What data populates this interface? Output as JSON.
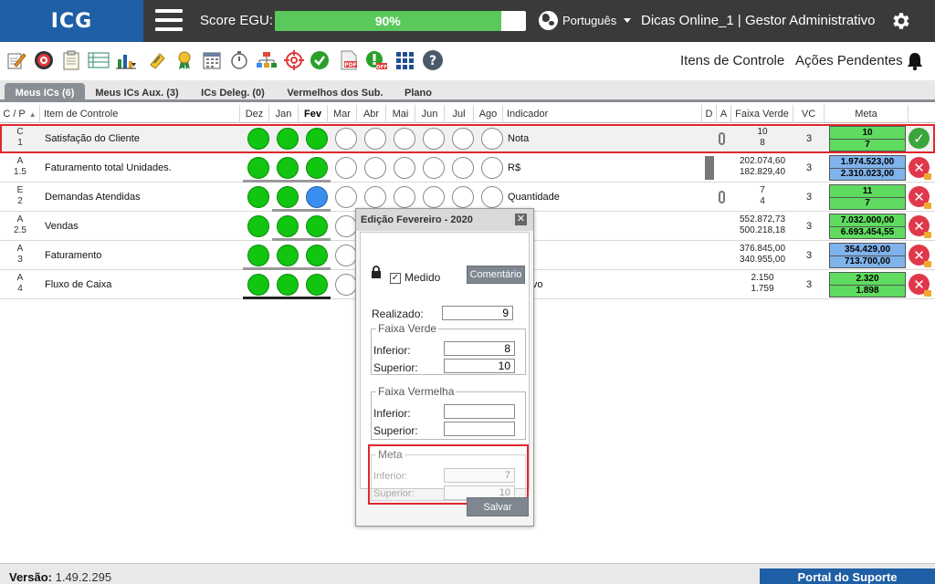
{
  "header": {
    "logo": "ICG",
    "score_label": "Score EGU:",
    "score_value": "90%",
    "score_fraction": 0.9,
    "language": "Português",
    "user_info": "Dicas Online_1  |  Gestor Administrativo"
  },
  "toolbar": {
    "icons": [
      "edit-icon",
      "target-icon",
      "clipboard-icon",
      "list-icon",
      "chart-icon",
      "attachment-icon",
      "award-icon",
      "calendar-icon",
      "timer-icon",
      "org-chart-icon",
      "crosshair-icon",
      "check-icon",
      "pdf-icon",
      "alert-off-icon",
      "grid-icon",
      "help-icon"
    ],
    "itens_controle": "Itens de Controle",
    "acoes_pendentes": "Ações Pendentes"
  },
  "tabs": [
    "Meus ICs (6)",
    "Meus ICs Aux. (3)",
    "ICs Deleg. (0)",
    "Vermelhos dos Sub.",
    "Plano"
  ],
  "table": {
    "headers": {
      "cp": "C / P",
      "item": "Item de Controle",
      "months": [
        "Dez",
        "Jan",
        "Fev",
        "Mar",
        "Abr",
        "Mai",
        "Jun",
        "Jul",
        "Ago"
      ],
      "indicador": "Indicador",
      "d": "D",
      "a": "A",
      "faixa": "Faixa Verde",
      "vc": "VC",
      "meta": "Meta"
    },
    "rows": [
      {
        "cp1": "C",
        "cp2": "1",
        "item": "Satisfação do Cliente",
        "indicador": "Nota",
        "faixa1": "10",
        "faixa2": "8",
        "vc": "3",
        "meta1": "10",
        "meta2": "7"
      },
      {
        "cp1": "A",
        "cp2": "1.5",
        "item": "Faturamento total Unidades.",
        "indicador": "R$",
        "faixa1": "202.074,60",
        "faixa2": "182.829,40",
        "vc": "3",
        "meta1": "1.974.523,00",
        "meta2": "2.310.023,00"
      },
      {
        "cp1": "E",
        "cp2": "2",
        "item": "Demandas Atendidas",
        "indicador": "Quantidade",
        "faixa1": "7",
        "faixa2": "4",
        "vc": "3",
        "meta1": "11",
        "meta2": "7"
      },
      {
        "cp1": "A",
        "cp2": "2.5",
        "item": "Vendas",
        "indicador": "",
        "faixa1": "552.872,73",
        "faixa2": "500.218,18",
        "vc": "3",
        "meta1": "7.032.000,00",
        "meta2": "6.693.454,55"
      },
      {
        "cp1": "A",
        "cp2": "3",
        "item": "Faturamento",
        "indicador": "",
        "faixa1": "376.845,00",
        "faixa2": "340.955,00",
        "vc": "3",
        "meta1": "354.429,00",
        "meta2": "713.700,00"
      },
      {
        "cp1": "A",
        "cp2": "4",
        "item": "Fluxo de Caixa",
        "indicador": "do ativo",
        "faixa1": "2.150",
        "faixa2": "1.759",
        "vc": "3",
        "meta1": "2.320",
        "meta2": "1.898"
      }
    ]
  },
  "dialog": {
    "title": "Edição Fevereiro - 2020",
    "close": "✕",
    "medido_label": "Medido",
    "comentario_button": "Comentário",
    "realizado_label": "Realizado:",
    "realizado_value": "9",
    "faixa_verde_legend": "Faixa Verde",
    "faixa_vermelha_legend": "Faixa Vermelha",
    "meta_legend": "Meta",
    "inferior_label": "Inferior:",
    "superior_label": "Superior:",
    "verde_inferior": "8",
    "verde_superior": "10",
    "vermelha_inferior": "",
    "vermelha_superior": "",
    "meta_inferior": "7",
    "meta_superior": "10",
    "salvar_button": "Salvar"
  },
  "footer": {
    "version_label": "Versão:",
    "version_value": "1.49.2.295",
    "support": "Portal do Suporte"
  },
  "colors": {
    "brand_blue": "#1f5fa6",
    "status_green": "#11c511",
    "status_blue": "#3a8ef0",
    "alert_red": "#e0282c",
    "header_dark": "#3a3a3a"
  }
}
